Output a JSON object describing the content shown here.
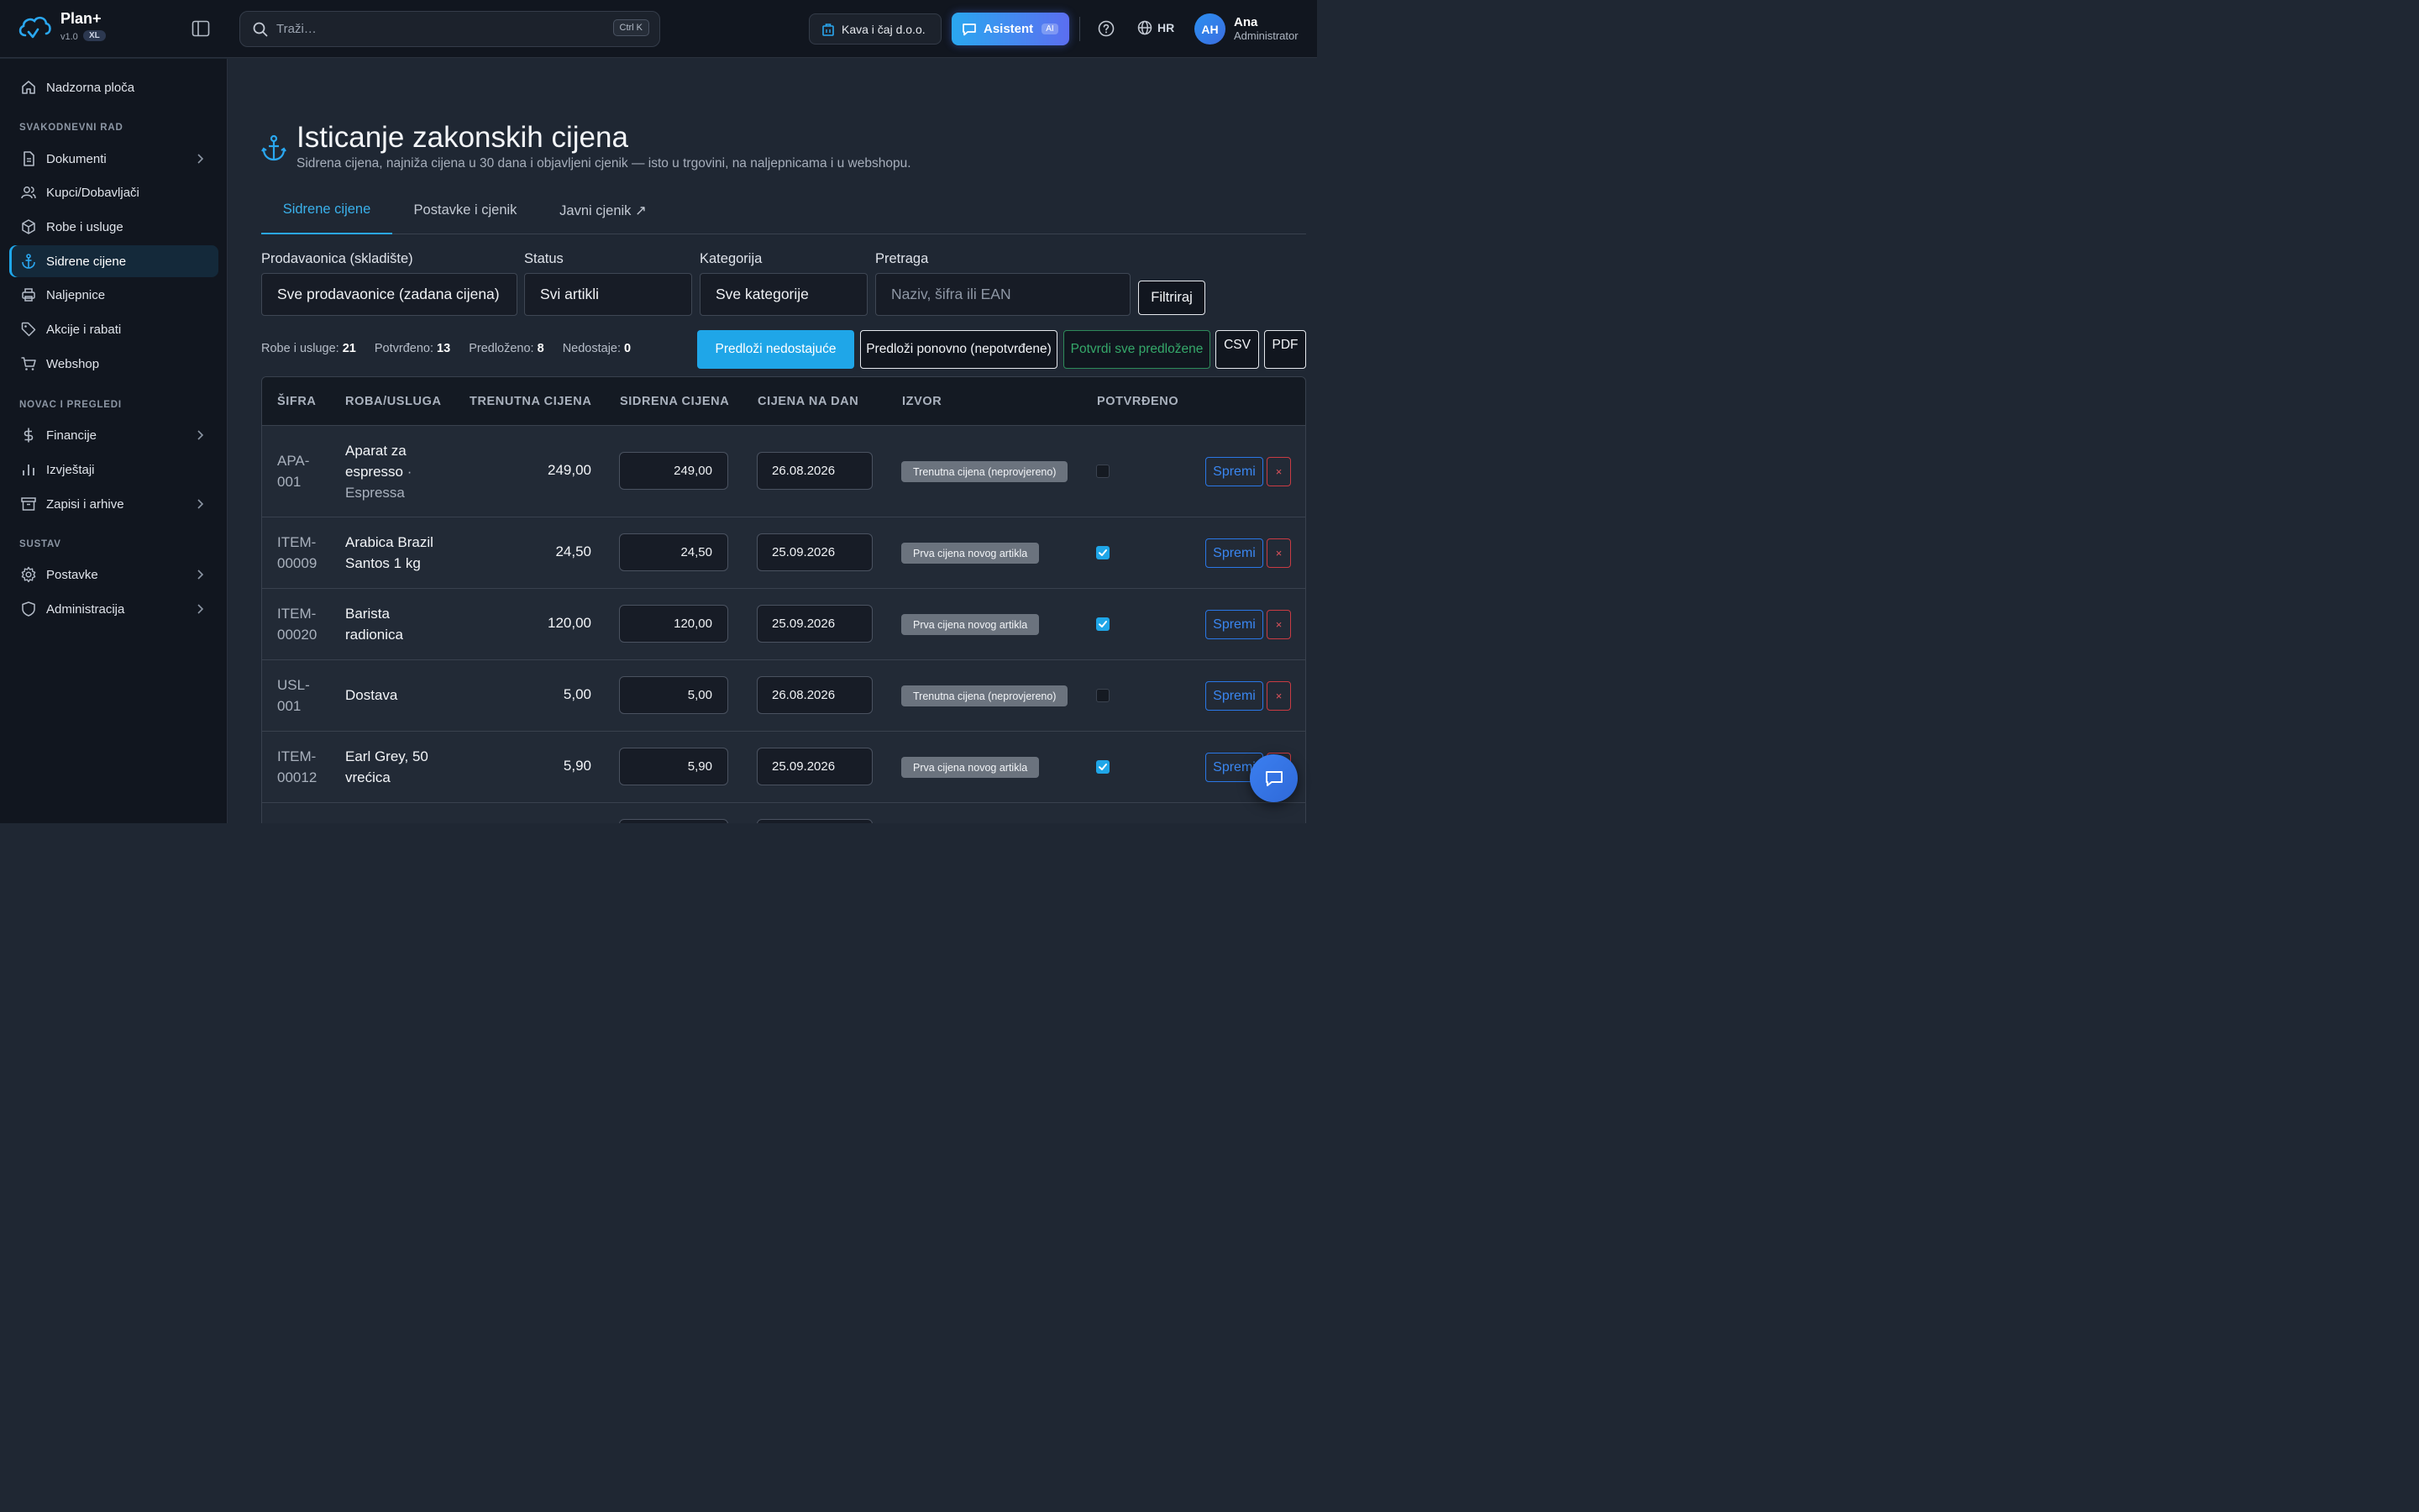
{
  "app": {
    "name": "Plan+",
    "version": "v1.0",
    "version_badge": "XL"
  },
  "topbar": {
    "search_placeholder": "Traži…",
    "search_shortcut": "Ctrl K",
    "company": "Kava i čaj d.o.o.",
    "assistant_label": "Asistent",
    "assistant_badge": "AI",
    "language": "HR",
    "user_initials": "AH",
    "user_name": "Ana",
    "user_role": "Administrator"
  },
  "sidebar": {
    "home": "Nadzorna ploča",
    "section_daily": "SVAKODNEVNI RAD",
    "documents": "Dokumenti",
    "partners": "Kupci/Dobavljači",
    "goods": "Robe i usluge",
    "anchor_prices": "Sidrene cijene",
    "labels": "Naljepnice",
    "promotions": "Akcije i rabati",
    "webshop": "Webshop",
    "section_money": "NOVAC I PREGLEDI",
    "finance": "Financije",
    "reports": "Izvještaji",
    "archives": "Zapisi i arhive",
    "section_system": "SUSTAV",
    "settings": "Postavke",
    "administration": "Administracija"
  },
  "page": {
    "title": "Isticanje zakonskih cijena",
    "subtitle": "Sidrena cijena, najniža cijena u 30 dana i objavljeni cjenik — isto u trgovini, na naljepnicama i u webshopu."
  },
  "tabs": {
    "anchor": "Sidrene cijene",
    "settings": "Postavke i cjenik",
    "public": "Javni cjenik ↗"
  },
  "filters": {
    "store_label": "Prodavaonica (skladište)",
    "store_value": "Sve prodavaonice (zadana cijena)",
    "status_label": "Status",
    "status_value": "Svi artikli",
    "category_label": "Kategorija",
    "category_value": "Sve kategorije",
    "search_label": "Pretraga",
    "search_placeholder": "Naziv, šifra ili EAN",
    "filter_button": "Filtriraj"
  },
  "stats": {
    "goods_label": "Robe i usluge:",
    "goods_value": "21",
    "confirmed_label": "Potvrđeno:",
    "confirmed_value": "13",
    "proposed_label": "Predloženo:",
    "proposed_value": "8",
    "missing_label": "Nedostaje:",
    "missing_value": "0"
  },
  "actions": {
    "propose_missing": "Predloži nedostajuće",
    "propose_again": "Predloži ponovno (nepotvrđene)",
    "confirm_all": "Potvrdi sve predložene",
    "csv": "CSV",
    "pdf": "PDF"
  },
  "table": {
    "headers": {
      "code": "ŠIFRA",
      "item": "ROBA/USLUGA",
      "current": "TRENUTNA CIJENA",
      "anchor": "SIDRENA CIJENA",
      "date": "CIJENA NA DAN",
      "source": "IZVOR",
      "confirmed": "POTVRĐENO"
    },
    "save_label": "Spremi",
    "delete_label": "×",
    "rows": [
      {
        "code": "APA-001",
        "name": "Aparat za espresso",
        "category": "· Espressa",
        "current": "249,00",
        "anchor": "249,00",
        "date": "26.08.2026",
        "source": "Trenutna cijena (neprovjereno)",
        "confirmed": false
      },
      {
        "code": "ITEM-00009",
        "name": "Arabica Brazil Santos 1 kg",
        "category": "",
        "current": "24,50",
        "anchor": "24,50",
        "date": "25.09.2026",
        "source": "Prva cijena novog artikla",
        "confirmed": true
      },
      {
        "code": "ITEM-00020",
        "name": "Barista radionica",
        "category": "",
        "current": "120,00",
        "anchor": "120,00",
        "date": "25.09.2026",
        "source": "Prva cijena novog artikla",
        "confirmed": true
      },
      {
        "code": "USL-001",
        "name": "Dostava",
        "category": "",
        "current": "5,00",
        "anchor": "5,00",
        "date": "26.08.2026",
        "source": "Trenutna cijena (neprovjereno)",
        "confirmed": false
      },
      {
        "code": "ITEM-00012",
        "name": "Earl Grey, 50 vrećica",
        "category": "",
        "current": "5,90",
        "anchor": "5,90",
        "date": "25.09.2026",
        "source": "Prva cijena novog artikla",
        "confirmed": true
      }
    ]
  },
  "colors": {
    "accent": "#1fa6e8",
    "background": "#1f2733",
    "sidebar": "#11161f",
    "success": "#35a86a",
    "danger": "#e0535b"
  }
}
